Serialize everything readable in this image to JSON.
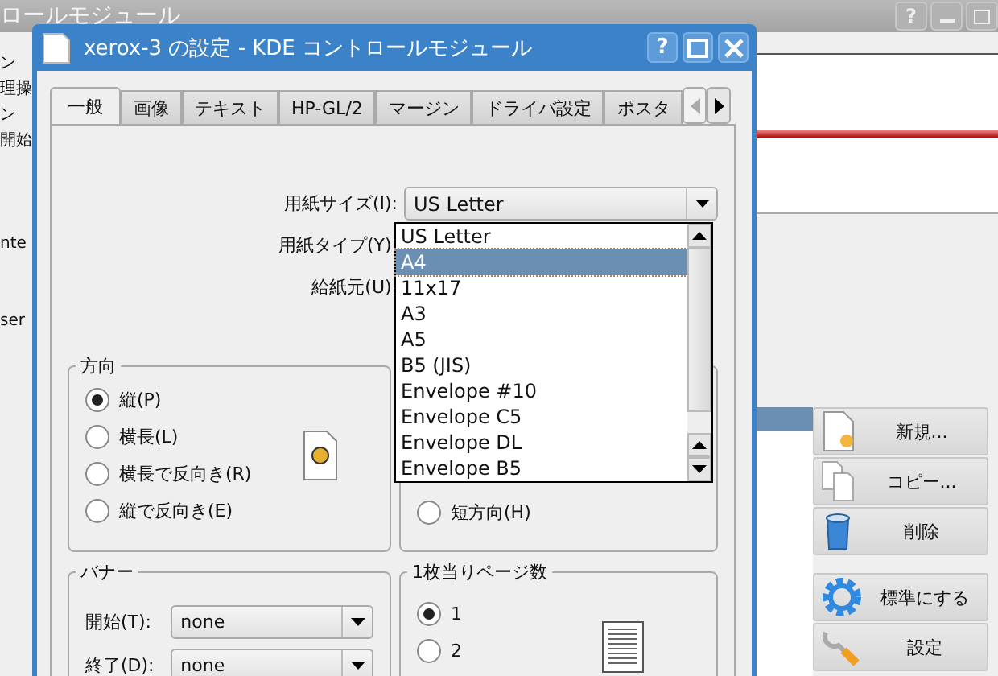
{
  "background_window": {
    "title": "ロールモジュール",
    "help_button": "?",
    "side_texts": [
      "ン",
      "理操",
      "ン",
      "開始",
      "nte",
      "ser"
    ],
    "list_rows": [
      {
        "selected": true
      }
    ],
    "action_buttons": [
      {
        "kind": "new",
        "label": "新規..."
      },
      {
        "kind": "copy",
        "label": "コピー..."
      },
      {
        "kind": "delete",
        "label": "削除"
      },
      {
        "kind": "default",
        "label": "標準にする"
      },
      {
        "kind": "settings",
        "label": "設定"
      }
    ]
  },
  "dialog": {
    "title": "xerox-3 の設定 - KDE コントロールモジュール",
    "help_button": "?",
    "tabs": [
      {
        "label": "一般",
        "selected": true
      },
      {
        "label": "画像",
        "selected": false
      },
      {
        "label": "テキスト",
        "selected": false
      },
      {
        "label": "HP-GL/2",
        "selected": false
      },
      {
        "label": "マージン",
        "selected": false
      },
      {
        "label": "ドライバ設定",
        "selected": false
      },
      {
        "label": "ポスタ",
        "selected": false
      }
    ],
    "tab_scroll_buttons": [
      {
        "kind": "left",
        "disabled": true
      },
      {
        "kind": "right",
        "disabled": false
      }
    ],
    "form_fields": [
      {
        "label": "用紙サイズ(I):",
        "value": "US Letter"
      },
      {
        "label": "用紙タイプ(Y):"
      },
      {
        "label": "給紙元(U):"
      }
    ],
    "paper_size_popup": [
      {
        "label": "US Letter",
        "selected": false
      },
      {
        "label": "A4",
        "selected": true
      },
      {
        "label": "11x17",
        "selected": false
      },
      {
        "label": "A3",
        "selected": false
      },
      {
        "label": "A5",
        "selected": false
      },
      {
        "label": "B5 (JIS)",
        "selected": false
      },
      {
        "label": "Envelope #10",
        "selected": false
      },
      {
        "label": "Envelope C5",
        "selected": false
      },
      {
        "label": "Envelope DL",
        "selected": false
      },
      {
        "label": "Envelope B5",
        "selected": false
      }
    ],
    "orientation": {
      "title": "方向",
      "options": [
        {
          "label": "縦(P)",
          "selected": true
        },
        {
          "label": "横長(L)",
          "selected": false
        },
        {
          "label": "横長で反向き(R)",
          "selected": false
        },
        {
          "label": "縦で反向き(E)",
          "selected": false
        }
      ]
    },
    "duplex": {
      "options": [
        {
          "label": "短方向(H)",
          "selected": false
        }
      ]
    },
    "banner": {
      "title": "バナー",
      "fields": [
        {
          "label": "開始(T):",
          "value": "none"
        },
        {
          "label": "終了(D):",
          "value": "none"
        }
      ]
    },
    "pages_per_sheet": {
      "title": "1枚当りページ数",
      "options": [
        {
          "label": "1",
          "selected": true
        },
        {
          "label": "2",
          "selected": false
        }
      ]
    }
  }
}
